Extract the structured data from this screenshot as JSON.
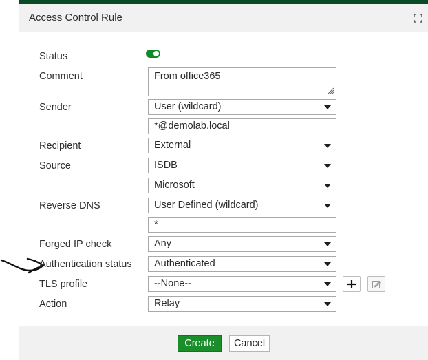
{
  "header": {
    "title": "Access Control Rule"
  },
  "labels": {
    "status": "Status",
    "comment": "Comment",
    "sender": "Sender",
    "recipient": "Recipient",
    "source": "Source",
    "reverse_dns": "Reverse DNS",
    "forged_ip": "Forged IP check",
    "auth_status": "Authentication status",
    "tls_profile": "TLS profile",
    "action": "Action"
  },
  "values": {
    "status_enabled": true,
    "comment": "From office365",
    "sender_type": "User (wildcard)",
    "sender_pattern": "*@demolab.local",
    "recipient": "External",
    "source_type": "ISDB",
    "source_value": "Microsoft",
    "reverse_dns_type": "User Defined (wildcard)",
    "reverse_dns_pattern": "*",
    "forged_ip": "Any",
    "auth_status": "Authenticated",
    "tls_profile": "--None--",
    "action": "Relay"
  },
  "buttons": {
    "create": "Create",
    "cancel": "Cancel"
  },
  "icons": {
    "expand": "expand-icon",
    "add": "plus-icon",
    "edit": "edit-icon",
    "dropdown": "chevron-down-icon"
  },
  "colors": {
    "top_strip": "#0b4a24",
    "accent_green": "#1b8e2c",
    "toggle_on": "#0e8a2a",
    "panel_bg": "#f1f1f1"
  }
}
